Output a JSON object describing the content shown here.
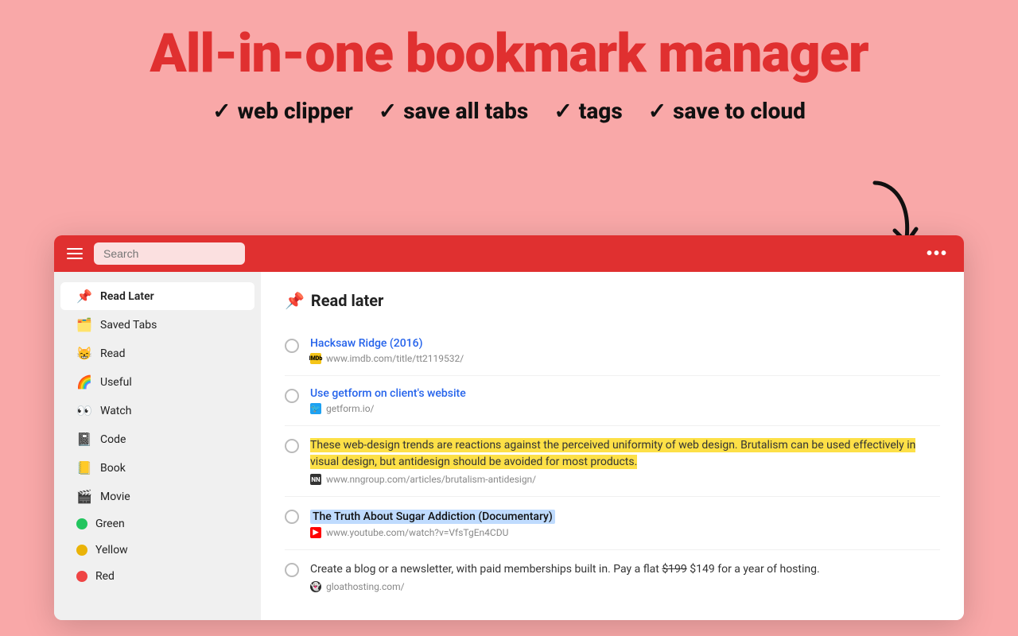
{
  "hero": {
    "title": "All-in-one bookmark manager",
    "features": [
      {
        "id": "web-clipper",
        "label": "web clipper"
      },
      {
        "id": "save-all-tabs",
        "label": "save all tabs"
      },
      {
        "id": "tags",
        "label": "tags"
      },
      {
        "id": "save-to-cloud",
        "label": "save to cloud"
      }
    ]
  },
  "toolbar": {
    "search_placeholder": "Search",
    "more_label": "•••"
  },
  "sidebar": {
    "items": [
      {
        "id": "read-later",
        "emoji": "📌",
        "label": "Read Later",
        "active": true
      },
      {
        "id": "saved-tabs",
        "emoji": "🗂️",
        "label": "Saved Tabs",
        "active": false
      },
      {
        "id": "read",
        "emoji": "😸",
        "label": "Read",
        "active": false
      },
      {
        "id": "useful",
        "emoji": "🌈",
        "label": "Useful",
        "active": false
      },
      {
        "id": "watch",
        "emoji": "👀",
        "label": "Watch",
        "active": false
      },
      {
        "id": "code",
        "emoji": "📓",
        "label": "Code",
        "active": false
      },
      {
        "id": "book",
        "emoji": "📒",
        "label": "Book",
        "active": false
      },
      {
        "id": "movie",
        "emoji": "🎬",
        "label": "Movie",
        "active": false
      },
      {
        "id": "green",
        "label": "Green",
        "color": "#22c55e",
        "active": false
      },
      {
        "id": "yellow",
        "label": "Yellow",
        "color": "#eab308",
        "active": false
      },
      {
        "id": "red",
        "label": "Red",
        "color": "#ef4444",
        "active": false
      }
    ]
  },
  "panel": {
    "title_emoji": "📌",
    "title": "Read later",
    "bookmarks": [
      {
        "id": "hacksaw-ridge",
        "title": "Hacksaw Ridge (2016)",
        "url": "www.imdb.com/title/tt2119532/",
        "favicon_type": "imdb",
        "favicon_text": "IMDb",
        "highlighted": false
      },
      {
        "id": "getform",
        "title": "Use getform on client's website",
        "url": "getform.io/",
        "favicon_type": "twitter",
        "favicon_text": "t",
        "highlighted": false
      },
      {
        "id": "brutalism",
        "title": "These web-design trends are reactions against the perceived uniformity of web design. Brutalism can be used effectively in visual design, but antidesign should be avoided for most products.",
        "url": "www.nngroup.com/articles/brutalism-antidesign/",
        "favicon_type": "nn",
        "favicon_text": "NN",
        "highlighted": true,
        "is_description": true
      },
      {
        "id": "sugar-addiction",
        "title": "The Truth About Sugar Addiction (Documentary)",
        "url": "www.youtube.com/watch?v=VfsTgEn4CDU",
        "favicon_type": "youtube",
        "favicon_text": "▶",
        "highlighted": false,
        "title_highlighted": true
      },
      {
        "id": "ghost-hosting",
        "title": "Create a blog or a newsletter, with paid memberships built in. Pay a flat $199 $149 for a year of hosting.",
        "url": "gloathosting.com/",
        "favicon_type": "ghost",
        "favicon_text": "G",
        "highlighted": false,
        "is_description": true
      }
    ]
  }
}
